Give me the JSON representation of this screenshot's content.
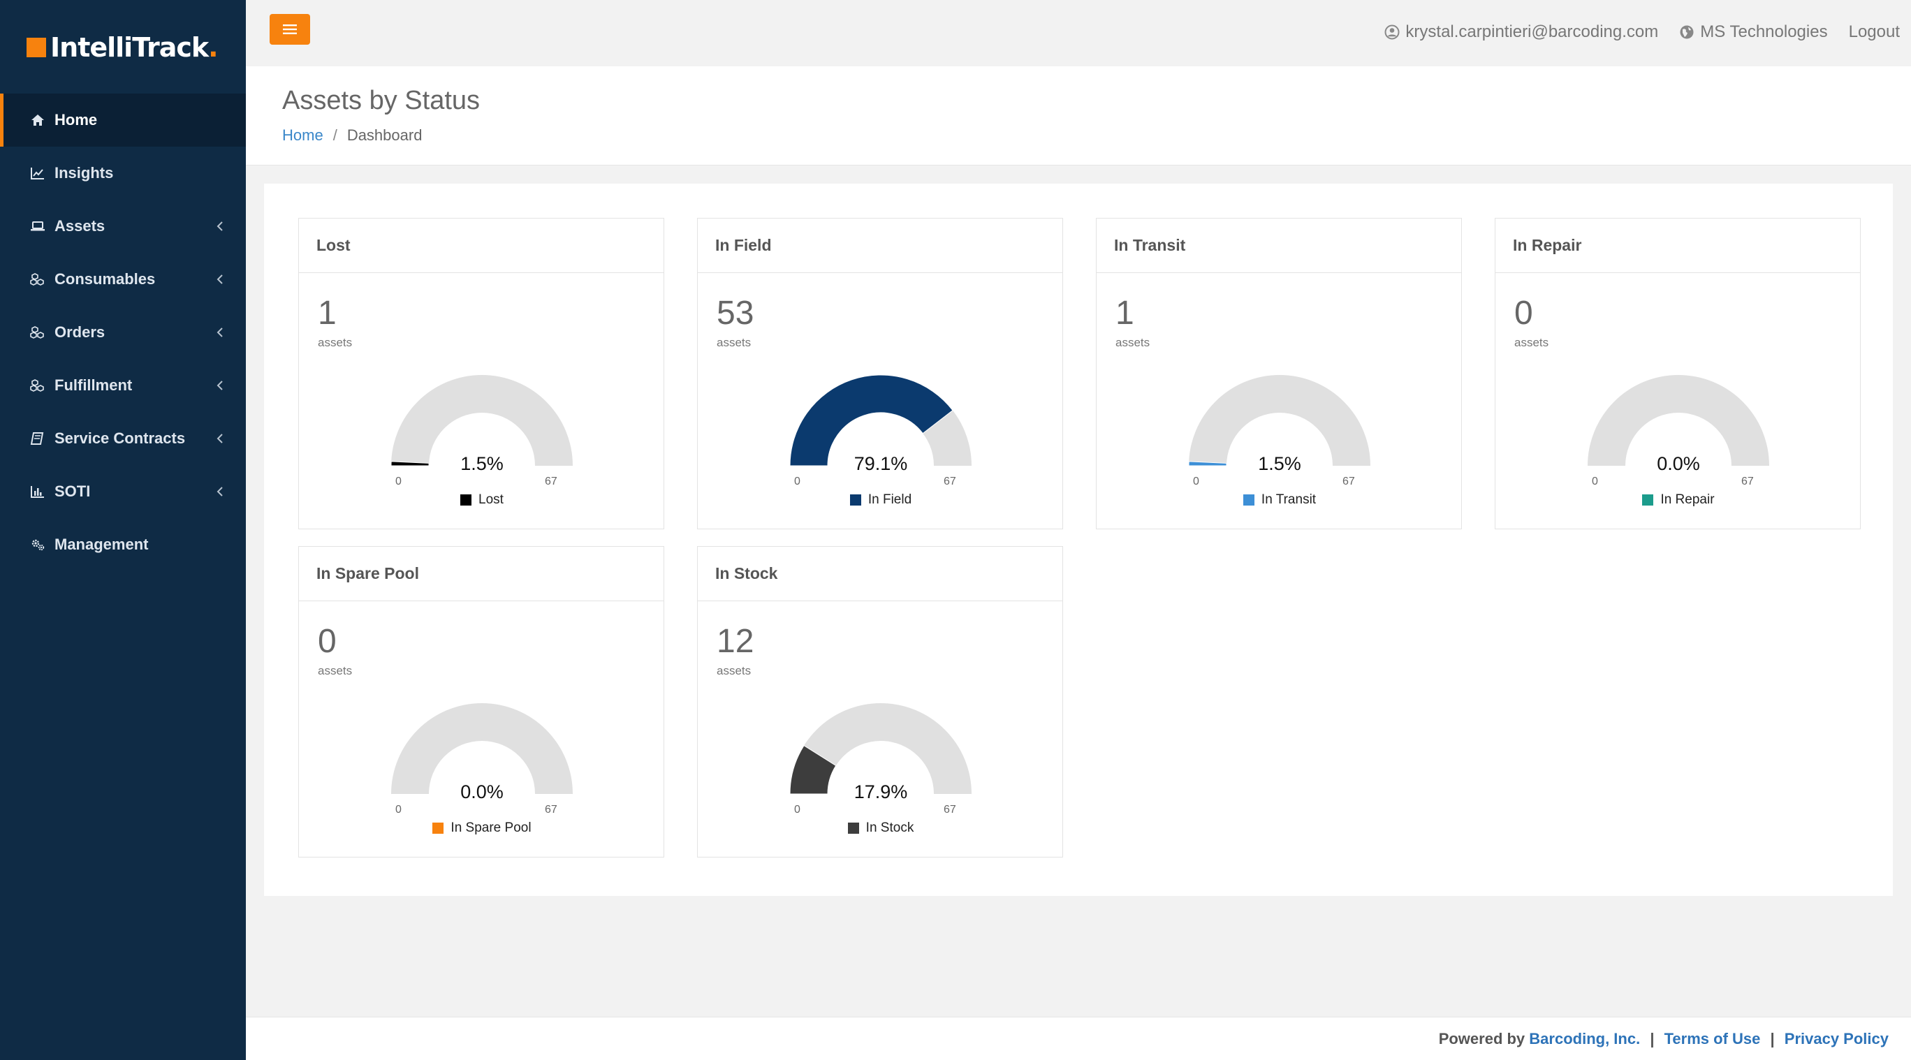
{
  "brand": {
    "name": "IntelliTrack",
    "dot": "."
  },
  "sidebar": {
    "items": [
      {
        "label": "Home",
        "icon": "home-icon",
        "active": true,
        "has_children": false
      },
      {
        "label": "Insights",
        "icon": "chart-line-icon",
        "active": false,
        "has_children": false
      },
      {
        "label": "Assets",
        "icon": "laptop-icon",
        "active": false,
        "has_children": true
      },
      {
        "label": "Consumables",
        "icon": "cubes-icon",
        "active": false,
        "has_children": true
      },
      {
        "label": "Orders",
        "icon": "cubes-icon",
        "active": false,
        "has_children": true
      },
      {
        "label": "Fulfillment",
        "icon": "cubes-icon",
        "active": false,
        "has_children": true
      },
      {
        "label": "Service Contracts",
        "icon": "book-icon",
        "active": false,
        "has_children": true
      },
      {
        "label": "SOTI",
        "icon": "bar-chart-icon",
        "active": false,
        "has_children": true
      },
      {
        "label": "Management",
        "icon": "cogs-icon",
        "active": false,
        "has_children": false
      }
    ]
  },
  "topbar": {
    "user": "krystal.carpintieri@barcoding.com",
    "company": "MS Technologies",
    "logout": "Logout"
  },
  "page": {
    "title": "Assets by Status",
    "breadcrumb": {
      "home": "Home",
      "separator": "/",
      "current": "Dashboard"
    }
  },
  "colors": {
    "accent": "#f7820e",
    "sidebar": "#0f2b45",
    "gauge_track": "#e0e0e0"
  },
  "cards": [
    {
      "title": "Lost",
      "count": "1",
      "unit": "assets",
      "min": "0",
      "max": "67",
      "value": 1,
      "percent": "1.5%",
      "legend": "Lost",
      "color": "#000000"
    },
    {
      "title": "In Field",
      "count": "53",
      "unit": "assets",
      "min": "0",
      "max": "67",
      "value": 53,
      "percent": "79.1%",
      "legend": "In Field",
      "color": "#0b3a6e"
    },
    {
      "title": "In Transit",
      "count": "1",
      "unit": "assets",
      "min": "0",
      "max": "67",
      "value": 1,
      "percent": "1.5%",
      "legend": "In Transit",
      "color": "#3d8fd6"
    },
    {
      "title": "In Repair",
      "count": "0",
      "unit": "assets",
      "min": "0",
      "max": "67",
      "value": 0,
      "percent": "0.0%",
      "legend": "In Repair",
      "color": "#1c9c8c"
    },
    {
      "title": "In Spare Pool",
      "count": "0",
      "unit": "assets",
      "min": "0",
      "max": "67",
      "value": 0,
      "percent": "0.0%",
      "legend": "In Spare Pool",
      "color": "#f7820e"
    },
    {
      "title": "In Stock",
      "count": "12",
      "unit": "assets",
      "min": "0",
      "max": "67",
      "value": 12,
      "percent": "17.9%",
      "legend": "In Stock",
      "color": "#3d3d3d"
    }
  ],
  "footer": {
    "powered_by": "Powered by",
    "company": "Barcoding, Inc.",
    "sep": "|",
    "terms": "Terms of Use",
    "privacy": "Privacy Policy"
  }
}
